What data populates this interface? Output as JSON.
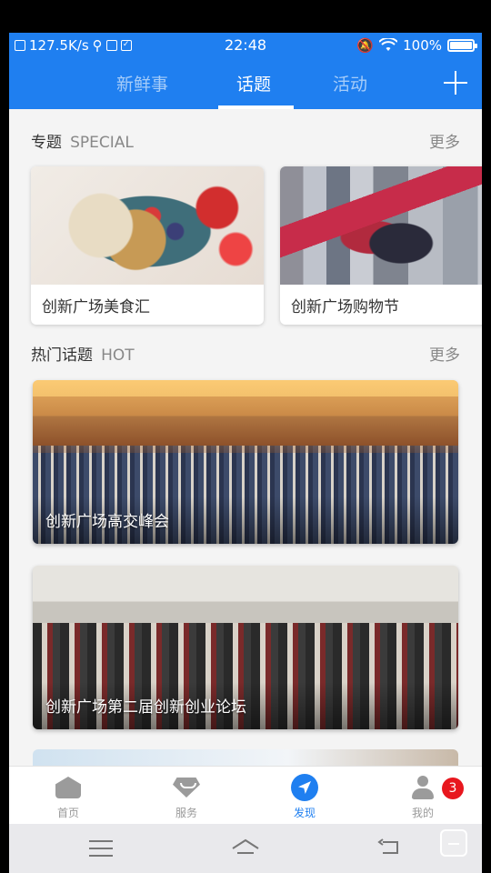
{
  "status_bar": {
    "speed": "127.5K/s",
    "time": "22:48",
    "battery": "100%"
  },
  "header": {
    "tabs": [
      {
        "label": "新鲜事",
        "active": false
      },
      {
        "label": "话题",
        "active": true
      },
      {
        "label": "活动",
        "active": false
      }
    ],
    "add_icon": "plus-icon"
  },
  "special": {
    "title": "专题",
    "subtitle": "SPECIAL",
    "more": "更多",
    "cards": [
      {
        "caption": "创新广场美食汇"
      },
      {
        "caption": "创新广场购物节"
      }
    ]
  },
  "hot": {
    "title": "热门话题",
    "subtitle": "HOT",
    "more": "更多",
    "cards": [
      {
        "caption": "创新广场高交峰会"
      },
      {
        "caption": "创新广场第二届创新创业论坛"
      }
    ]
  },
  "bottom_nav": {
    "items": [
      {
        "label": "首页",
        "icon": "home-icon",
        "active": false
      },
      {
        "label": "服务",
        "icon": "service-icon",
        "active": false
      },
      {
        "label": "发现",
        "icon": "discover-icon",
        "active": true
      },
      {
        "label": "我的",
        "icon": "user-icon",
        "active": false
      }
    ],
    "badge_count": "3"
  },
  "colors": {
    "primary": "#1f7ff0",
    "badge": "#e8171e"
  }
}
